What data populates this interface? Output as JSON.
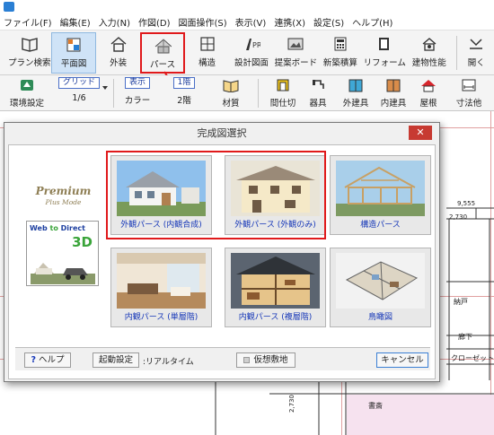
{
  "menu": [
    "ファイル(F)",
    "編集(E)",
    "入力(N)",
    "作図(D)",
    "図面操作(S)",
    "表示(V)",
    "連携(X)",
    "設定(S)",
    "ヘルプ(H)"
  ],
  "toolbar1": {
    "plan_search": "プラン検索",
    "floor_plan": "平面図",
    "exterior": "外装",
    "perspective": "パース",
    "structure": "構造",
    "design_drawing": "設計図面",
    "proposal_board": "提案ボード",
    "new_estimate": "新築積算",
    "reform": "リフォーム",
    "building_performance": "建物性能",
    "open": "開く"
  },
  "toolbar2": {
    "env_settings": "環境設定",
    "grid_chip": "グリッド",
    "grid_value": "1/6",
    "display_chip": "表示",
    "display_value": "カラー",
    "floor_chip": "1階",
    "floor_value": "2階",
    "material": "材質",
    "partition": "間仕切",
    "fixture": "器具",
    "exterior_fitting": "外建具",
    "interior_fitting": "内建具",
    "roof": "屋根",
    "dimension": "寸法他"
  },
  "canvas": {
    "dim_9555": "9,555",
    "dim_2730": "2,730",
    "dim_2730_b": "2,730",
    "room_storage": "納戸",
    "room_hall": "廊下",
    "room_closet": "クローゼット",
    "room_study": "書斎"
  },
  "dialog": {
    "title": "完成図選択",
    "close": "✕",
    "premium_title": "Premium",
    "premium_sub": "Plus Mode",
    "web_to_direct_a": "Web",
    "web_to_direct_b": "to",
    "web_to_direct_c": "Direct",
    "web_to_direct_3d": "3D",
    "tiles": [
      "外観パース (内観合成)",
      "外観パース (外観のみ)",
      "構造パース",
      "内観パース (単層階)",
      "内観パース (複層階)",
      "鳥瞰図"
    ],
    "help": "ヘルプ",
    "startup_settings": "起動設定",
    "startup_mode": ":リアルタイム",
    "virtual_site": "仮想敷地",
    "cancel": "キャンセル"
  },
  "colors": {
    "highlight": "#e0191b",
    "link_text": "#1637b8",
    "close_button": "#c73a32"
  }
}
